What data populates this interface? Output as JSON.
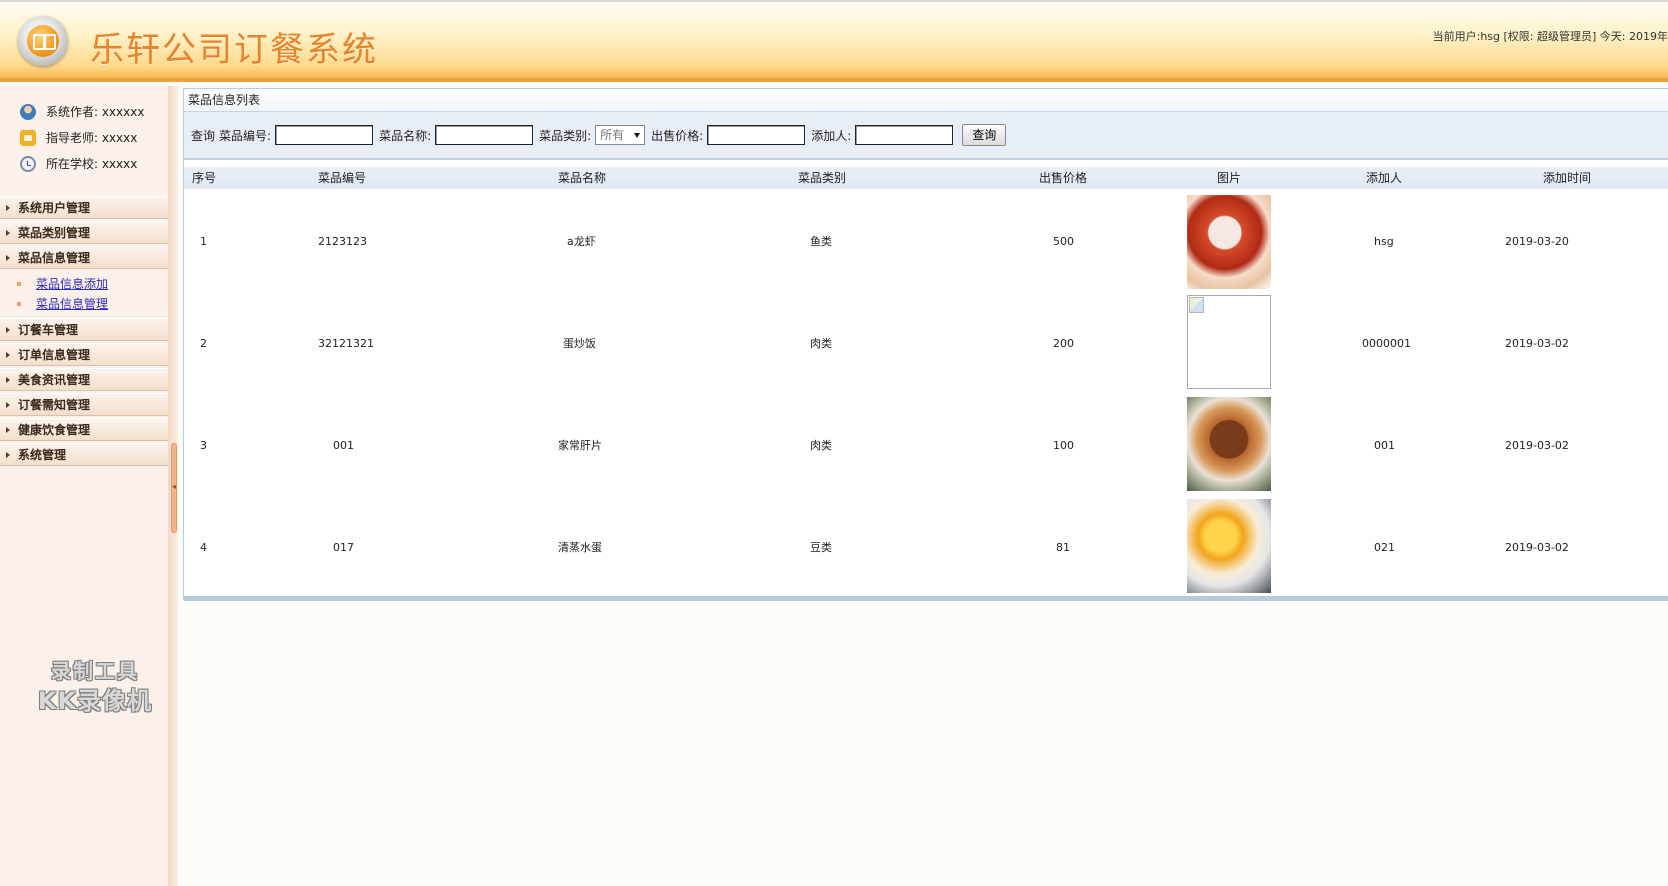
{
  "header": {
    "app_title": "乐轩公司订餐系统",
    "user_info": "当前用户:hsg [权限: 超级管理员] 今天: 2019年"
  },
  "sidebar": {
    "info": [
      {
        "label": "系统作者: xxxxxx",
        "icon": "author-icon"
      },
      {
        "label": "指导老师: xxxxx",
        "icon": "teacher-icon"
      },
      {
        "label": "所在学校: xxxxx",
        "icon": "school-icon"
      }
    ],
    "menu": [
      {
        "label": "系统用户管理"
      },
      {
        "label": "菜品类别管理"
      },
      {
        "label": "菜品信息管理",
        "children": [
          {
            "label": "菜品信息添加"
          },
          {
            "label": "菜品信息管理"
          }
        ]
      },
      {
        "label": "订餐车管理"
      },
      {
        "label": "订单信息管理"
      },
      {
        "label": "美食资讯管理"
      },
      {
        "label": "订餐需知管理"
      },
      {
        "label": "健康饮食管理"
      },
      {
        "label": "系统管理"
      }
    ],
    "watermark_line1": "录制工具",
    "watermark_line2": "KK录像机"
  },
  "panel": {
    "title": "菜品信息列表"
  },
  "search": {
    "prefix": "查询",
    "code_label": "菜品编号:",
    "code_value": "",
    "name_label": "菜品名称:",
    "name_value": "",
    "category_label": "菜品类别:",
    "category_selected": "所有",
    "price_label": "出售价格:",
    "price_value": "",
    "adder_label": "添加人:",
    "adder_value": "",
    "submit_label": "查询"
  },
  "table": {
    "columns": [
      "序号",
      "菜品编号",
      "菜品名称",
      "菜品类别",
      "出售价格",
      "图片",
      "添加人",
      "添加时间"
    ],
    "rows": [
      {
        "index": "1",
        "code": "2123123",
        "name": "a龙虾",
        "category": "鱼类",
        "price": "500",
        "image": "lobster-dish-photo",
        "adder": "hsg",
        "time": "2019-03-20"
      },
      {
        "index": "2",
        "code": "32121321",
        "name": "蛋炒饭",
        "category": "肉类",
        "price": "200",
        "image": "broken-image",
        "adder": "0000001",
        "time": "2019-03-02"
      },
      {
        "index": "3",
        "code": "001",
        "name": "家常肝片",
        "category": "肉类",
        "price": "100",
        "image": "roast-meat-photo",
        "adder": "001",
        "time": "2019-03-02"
      },
      {
        "index": "4",
        "code": "017",
        "name": "清蒸水蛋",
        "category": "豆类",
        "price": "81",
        "image": "fries-cup-photo",
        "adder": "021",
        "time": "2019-03-02"
      }
    ]
  }
}
